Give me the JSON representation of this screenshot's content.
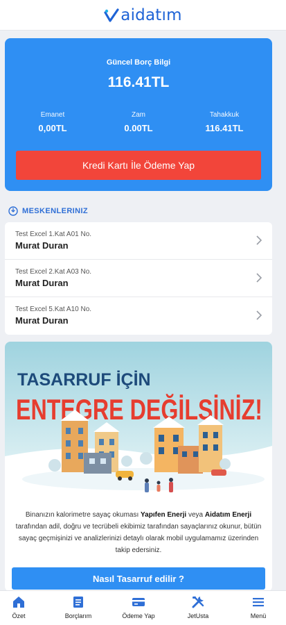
{
  "app": {
    "logo_text": "aidatım"
  },
  "debt": {
    "title": "Güncel Borç Bilgi",
    "amount": "116.41TL",
    "stats": [
      {
        "label": "Emanet",
        "value": "0,00TL"
      },
      {
        "label": "Zam",
        "value": "0.00TL"
      },
      {
        "label": "Tahakkuk",
        "value": "116.41TL"
      }
    ],
    "pay_button": "Kredi Kartı İle Ödeme Yap"
  },
  "residences": {
    "title": "MESKENLERINIZ",
    "items": [
      {
        "unit": "Test Excel 1.Kat A01 No.",
        "owner": "Murat Duran"
      },
      {
        "unit": "Test Excel 2.Kat A03 No.",
        "owner": "Murat Duran"
      },
      {
        "unit": "Test Excel 5.Kat A10 No.",
        "owner": "Murat Duran"
      }
    ]
  },
  "banner": {
    "headline_1": "TASARRUF İÇİN",
    "headline_2": "ENTEGRE DEĞİLSİNİZ!",
    "text_1": "Binanızın kalorimetre sayaç okuması ",
    "brand_1": "Yapıfen Enerji",
    "text_2": " veya ",
    "brand_2": "Aidatım Enerji",
    "text_3": " tarafından adil, doğru ve tecrübeli ekibimiz tarafından sayaçlarınız okunur, bütün sayaç geçmişinizi ve analizlerinizi detaylı olarak mobil uygulamamız üzerinden takip edersiniz.",
    "button": "Nasıl Tasarruf edilir ?"
  },
  "tabs": [
    {
      "label": "Özet",
      "icon": "home-icon"
    },
    {
      "label": "Borçlarım",
      "icon": "document-icon"
    },
    {
      "label": "Ödeme Yap",
      "icon": "credit-card-icon"
    },
    {
      "label": "JetUsta",
      "icon": "tools-icon"
    },
    {
      "label": "Menü",
      "icon": "hamburger-menu-icon"
    }
  ],
  "colors": {
    "primary": "#2f8ff3",
    "danger": "#f2453a",
    "brand": "#1e63d6"
  }
}
